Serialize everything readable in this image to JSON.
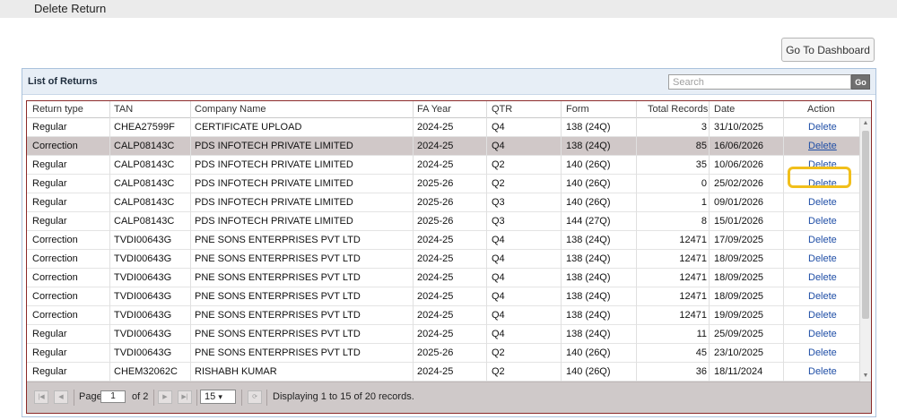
{
  "page": {
    "title": "Delete Return",
    "dashboard_button": "Go To Dashboard"
  },
  "panel": {
    "title": "List of Returns",
    "search_placeholder": "Search",
    "go_label": "Go"
  },
  "columns": [
    "Return type",
    "TAN",
    "Company Name",
    "FA Year",
    "QTR",
    "Form",
    "Total Records",
    "Date",
    "Action"
  ],
  "rows": [
    {
      "type": "Regular",
      "tan": "CHEA27599F",
      "company": "CERTIFICATE UPLOAD",
      "fy": "2024-25",
      "qtr": "Q4",
      "form": "138 (24Q)",
      "records": "3",
      "date": "31/10/2025",
      "action": "Delete"
    },
    {
      "type": "Correction",
      "tan": "CALP08143C",
      "company": "PDS INFOTECH PRIVATE LIMITED",
      "fy": "2024-25",
      "qtr": "Q4",
      "form": "138 (24Q)",
      "records": "85",
      "date": "16/06/2026",
      "action": "Delete"
    },
    {
      "type": "Regular",
      "tan": "CALP08143C",
      "company": "PDS INFOTECH PRIVATE LIMITED",
      "fy": "2024-25",
      "qtr": "Q2",
      "form": "140 (26Q)",
      "records": "35",
      "date": "10/06/2026",
      "action": "Delete"
    },
    {
      "type": "Regular",
      "tan": "CALP08143C",
      "company": "PDS INFOTECH PRIVATE LIMITED",
      "fy": "2025-26",
      "qtr": "Q2",
      "form": "140 (26Q)",
      "records": "0",
      "date": "25/02/2026",
      "action": "Delete"
    },
    {
      "type": "Regular",
      "tan": "CALP08143C",
      "company": "PDS INFOTECH PRIVATE LIMITED",
      "fy": "2025-26",
      "qtr": "Q3",
      "form": "140 (26Q)",
      "records": "1",
      "date": "09/01/2026",
      "action": "Delete"
    },
    {
      "type": "Regular",
      "tan": "CALP08143C",
      "company": "PDS INFOTECH PRIVATE LIMITED",
      "fy": "2025-26",
      "qtr": "Q3",
      "form": "144 (27Q)",
      "records": "8",
      "date": "15/01/2026",
      "action": "Delete"
    },
    {
      "type": "Correction",
      "tan": "TVDI00643G",
      "company": "PNE SONS ENTERPRISES PVT LTD",
      "fy": "2024-25",
      "qtr": "Q4",
      "form": "138 (24Q)",
      "records": "12471",
      "date": "17/09/2025",
      "action": "Delete"
    },
    {
      "type": "Correction",
      "tan": "TVDI00643G",
      "company": "PNE SONS ENTERPRISES PVT LTD",
      "fy": "2024-25",
      "qtr": "Q4",
      "form": "138 (24Q)",
      "records": "12471",
      "date": "18/09/2025",
      "action": "Delete"
    },
    {
      "type": "Correction",
      "tan": "TVDI00643G",
      "company": "PNE SONS ENTERPRISES PVT LTD",
      "fy": "2024-25",
      "qtr": "Q4",
      "form": "138 (24Q)",
      "records": "12471",
      "date": "18/09/2025",
      "action": "Delete"
    },
    {
      "type": "Correction",
      "tan": "TVDI00643G",
      "company": "PNE SONS ENTERPRISES PVT LTD",
      "fy": "2024-25",
      "qtr": "Q4",
      "form": "138 (24Q)",
      "records": "12471",
      "date": "18/09/2025",
      "action": "Delete"
    },
    {
      "type": "Correction",
      "tan": "TVDI00643G",
      "company": "PNE SONS ENTERPRISES PVT LTD",
      "fy": "2024-25",
      "qtr": "Q4",
      "form": "138 (24Q)",
      "records": "12471",
      "date": "19/09/2025",
      "action": "Delete"
    },
    {
      "type": "Regular",
      "tan": "TVDI00643G",
      "company": "PNE SONS ENTERPRISES PVT LTD",
      "fy": "2024-25",
      "qtr": "Q4",
      "form": "138 (24Q)",
      "records": "11",
      "date": "25/09/2025",
      "action": "Delete"
    },
    {
      "type": "Regular",
      "tan": "TVDI00643G",
      "company": "PNE SONS ENTERPRISES PVT LTD",
      "fy": "2025-26",
      "qtr": "Q2",
      "form": "140 (26Q)",
      "records": "45",
      "date": "23/10/2025",
      "action": "Delete"
    },
    {
      "type": "Regular",
      "tan": "CHEM32062C",
      "company": "RISHABH KUMAR",
      "fy": "2024-25",
      "qtr": "Q2",
      "form": "140 (26Q)",
      "records": "36",
      "date": "18/11/2024",
      "action": "Delete"
    }
  ],
  "selected_row": 1,
  "pager": {
    "page_label": "Page",
    "page_value": "1",
    "of_label": "of 2",
    "page_size": "15",
    "status": "Displaying 1 to 15 of 20 records."
  },
  "colors": {
    "highlight_box": "#f1bf1b",
    "link": "#1f4ea6",
    "selected_row_bg": "#d0c8c8",
    "grid_border": "#8b2a2a"
  }
}
